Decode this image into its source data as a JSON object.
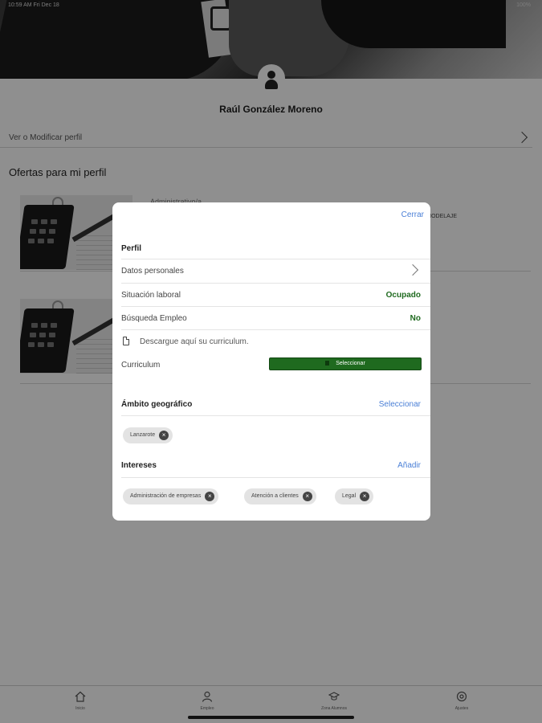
{
  "status_bar": {
    "left": "10:59 AM  Fri Dec 18",
    "right": "100%"
  },
  "profile": {
    "name": "Raúl González Moreno",
    "link_label": "Ver o Modificar perfil"
  },
  "offers": {
    "title": "Ofertas para mi perfil",
    "items": [
      {
        "title": "Administrativo/a",
        "company": "MODELAJE"
      },
      {
        "title": "",
        "company": ""
      }
    ]
  },
  "modal": {
    "close_label": "Cerrar",
    "perfil": {
      "title": "Perfil",
      "rows": [
        {
          "label": "Datos personales",
          "value": ""
        },
        {
          "label": "Situación laboral",
          "value": "Ocupado"
        },
        {
          "label": "Búsqueda Empleo",
          "value": "No"
        }
      ],
      "download_text": "Descargue aquí su curriculum.",
      "curriculum_label": "Curriculum",
      "select_button": "Seleccionar"
    },
    "ambito": {
      "title": "Ámbito geográfico",
      "action": "Seleccionar",
      "chips": [
        "Lanzarote"
      ]
    },
    "intereses": {
      "title": "Intereses",
      "action": "Añadir",
      "chips": [
        "Administración de empresas",
        "Atención a clientes",
        "Legal"
      ]
    }
  },
  "tabbar": {
    "tabs": [
      {
        "label": "Inicio",
        "icon": "home-icon"
      },
      {
        "label": "Empleo",
        "icon": "person-icon"
      },
      {
        "label": "Zona Alumnos",
        "icon": "graduation-cap-icon"
      },
      {
        "label": "Ajustes",
        "icon": "settings-icon"
      }
    ]
  },
  "colors": {
    "accent_green": "#1f6a1f",
    "link_blue": "#4a7fd6"
  }
}
